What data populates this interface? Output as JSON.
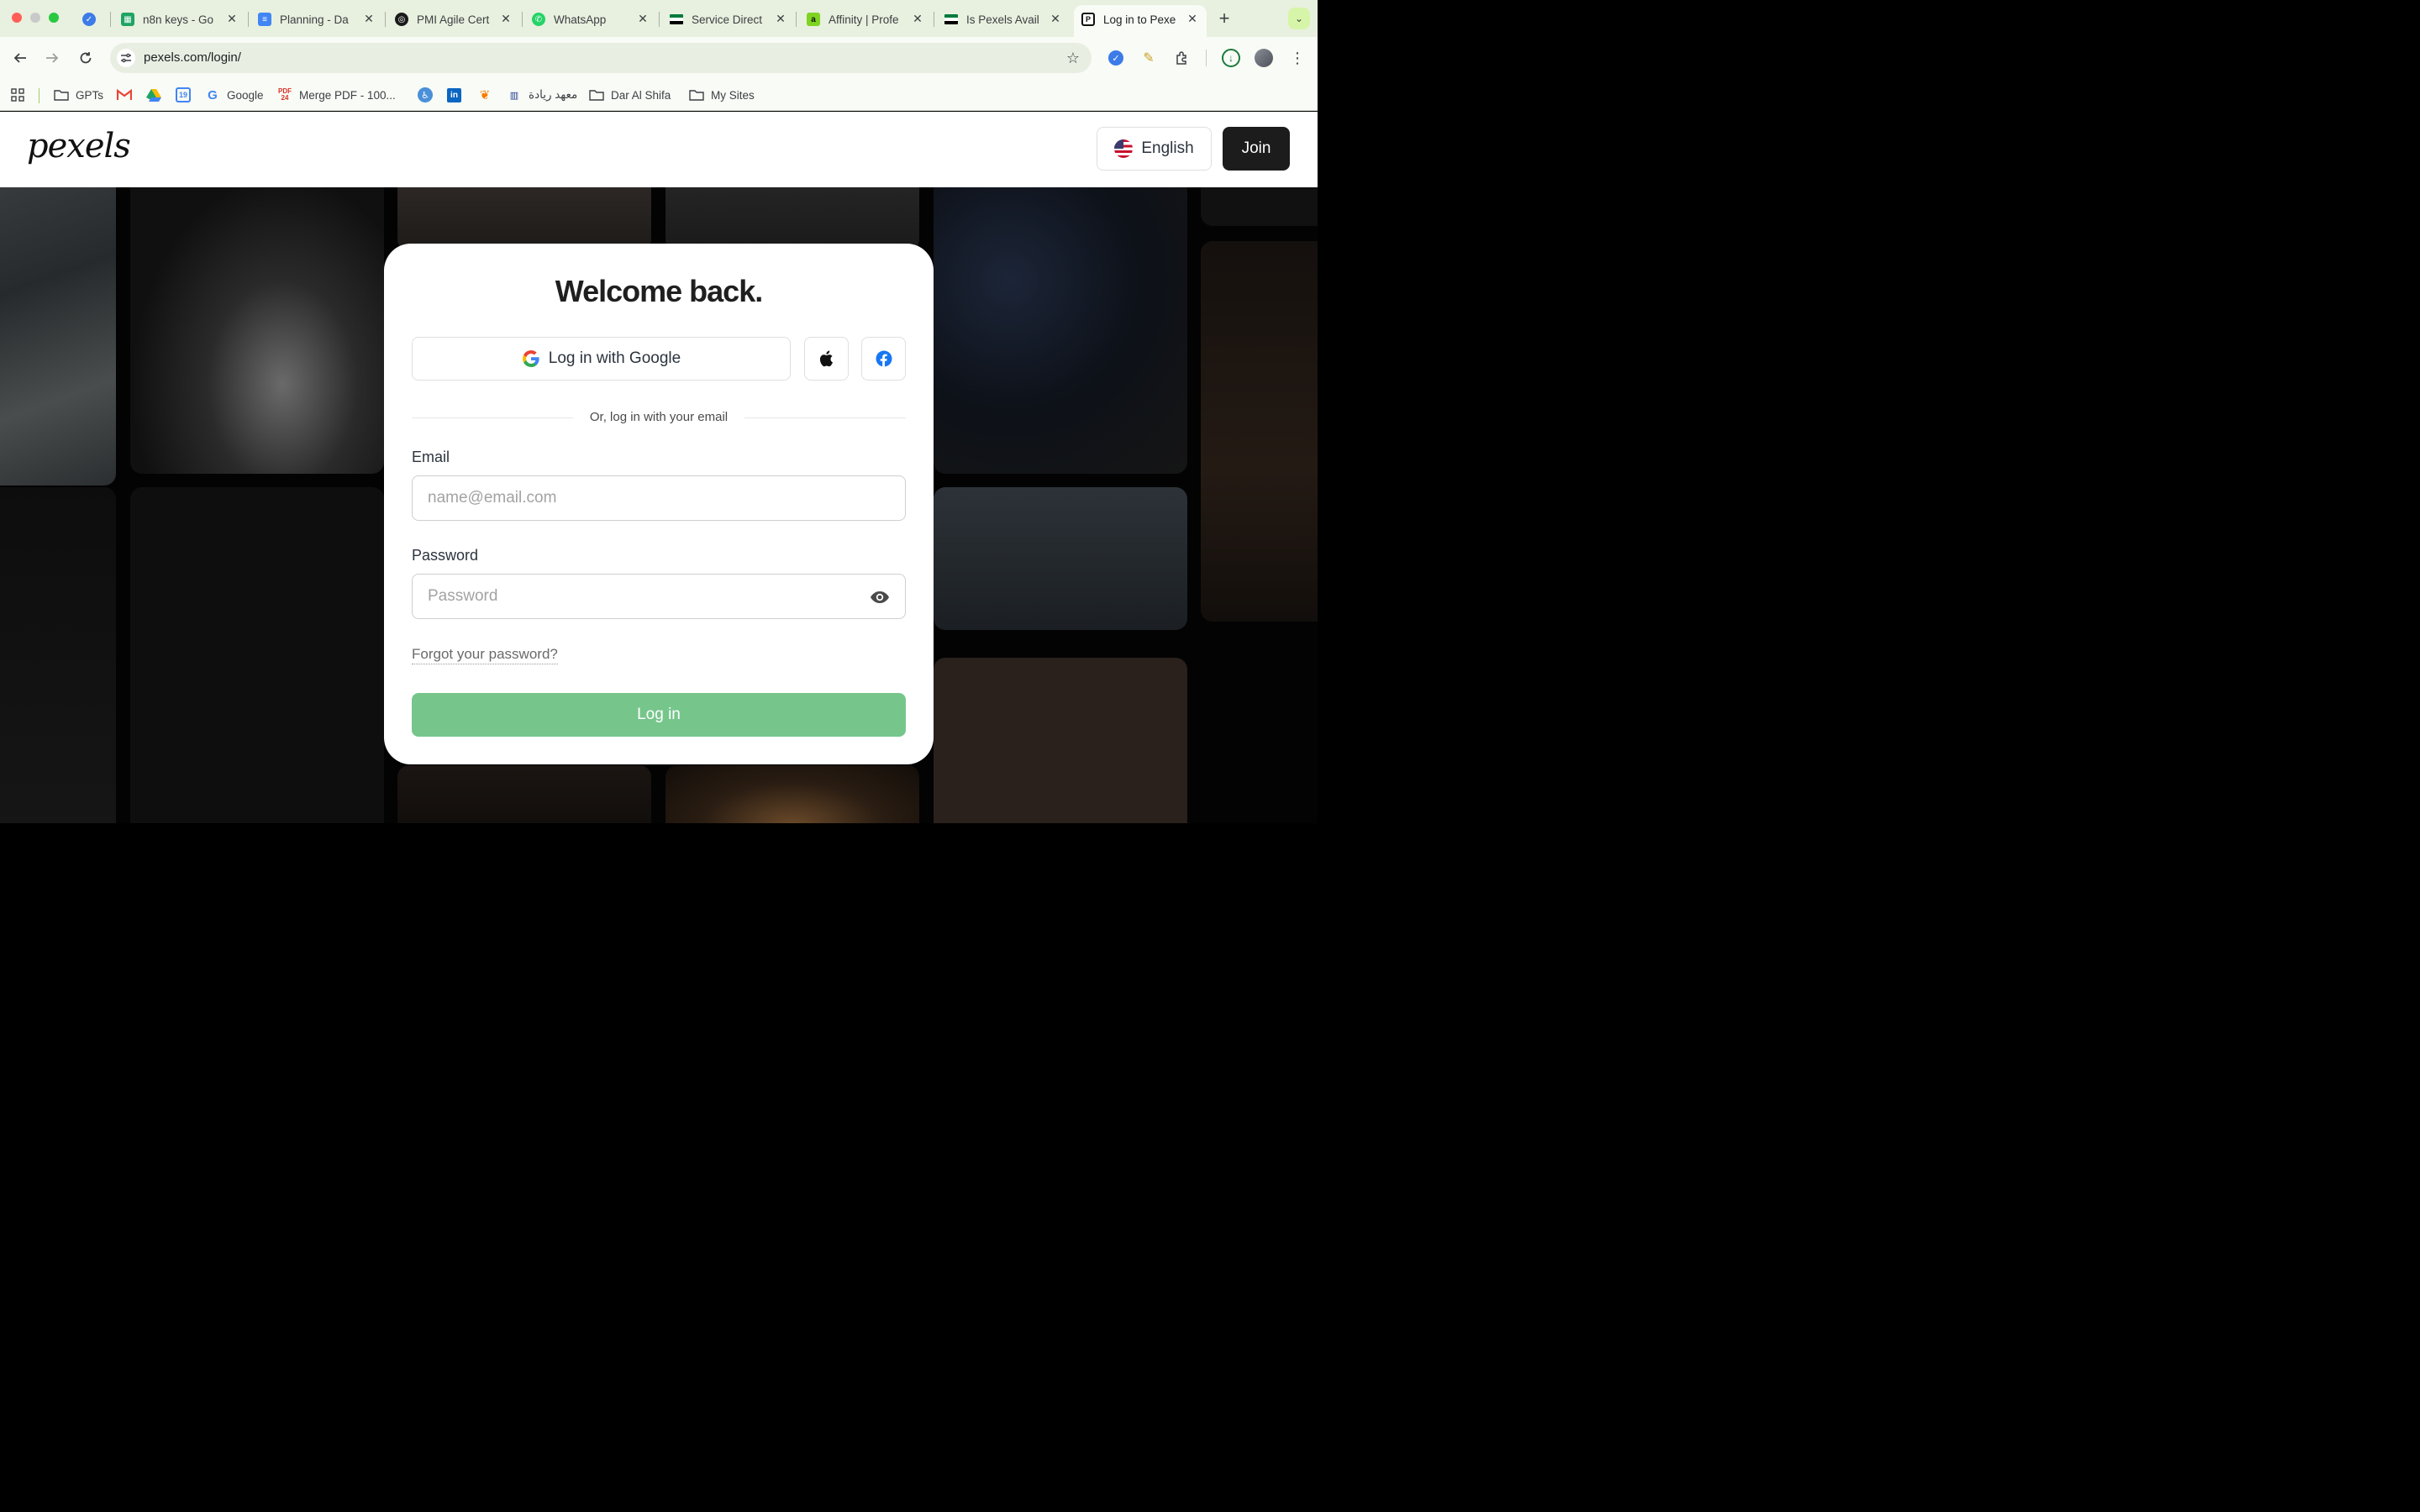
{
  "browser": {
    "tabs": [
      {
        "title": "",
        "icon": "checkmark-circle-icon",
        "color": "#3c7be8"
      },
      {
        "title": "n8n keys - Go",
        "icon": "google-sheets-icon",
        "color": "#1fa463"
      },
      {
        "title": "Planning - Da",
        "icon": "google-docs-icon",
        "color": "#4285f4"
      },
      {
        "title": "PMI Agile Cert",
        "icon": "pmi-icon",
        "color": "#1a1a1a"
      },
      {
        "title": "WhatsApp",
        "icon": "whatsapp-icon",
        "color": "#25d366"
      },
      {
        "title": "Service Direct",
        "icon": "flag-icon",
        "color": "#007a3d"
      },
      {
        "title": "Affinity | Profe",
        "icon": "affinity-icon",
        "color": "#7fd321"
      },
      {
        "title": "Is Pexels Avail",
        "icon": "flag-icon",
        "color": "#007a3d"
      },
      {
        "title": "Log in to Pexe",
        "icon": "pexels-icon",
        "color": "#05a081"
      }
    ],
    "url": "pexels.com/login/",
    "bookmarks": [
      {
        "label": "GPTs",
        "icon": "folder-icon"
      },
      {
        "label": "",
        "icon": "gmail-icon"
      },
      {
        "label": "",
        "icon": "google-drive-icon"
      },
      {
        "label": "",
        "icon": "google-calendar-icon"
      },
      {
        "label": "Google",
        "icon": "google-icon"
      },
      {
        "label": "Merge PDF - 100...",
        "icon": "pdf24-icon"
      },
      {
        "label": "",
        "icon": "accessibility-icon"
      },
      {
        "label": "",
        "icon": "linkedin-icon"
      },
      {
        "label": "",
        "icon": "flame-icon"
      },
      {
        "label": "معهد ريادة",
        "icon": "riyada-icon"
      },
      {
        "label": "Dar Al Shifa",
        "icon": "folder-icon"
      },
      {
        "label": "My Sites",
        "icon": "folder-icon"
      }
    ]
  },
  "header": {
    "logo": "pexels",
    "language_label": "English",
    "join_label": "Join"
  },
  "modal": {
    "title": "Welcome back.",
    "google_label": "Log in with Google",
    "divider_text": "Or, log in with your email",
    "email_label": "Email",
    "email_placeholder": "name@email.com",
    "password_label": "Password",
    "password_placeholder": "Password",
    "forgot_label": "Forgot your password?",
    "login_label": "Log in"
  },
  "colors": {
    "login_button": "#76c68c",
    "join_button": "#1c1c1c",
    "chrome_tabstrip": "#e8f0df"
  }
}
